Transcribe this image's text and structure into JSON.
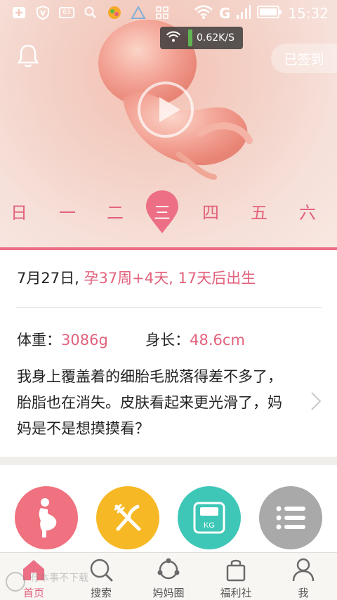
{
  "status_bar": {
    "battery_label": "63",
    "time": "15:32",
    "network_letter": "G"
  },
  "net_speed": "0.62K/S",
  "checkin_label": "已签到",
  "weekdays": [
    "日",
    "一",
    "二",
    "三",
    "四",
    "五",
    "六"
  ],
  "active_weekday_index": 3,
  "info": {
    "date": "7月27日,",
    "pregnancy": "孕37周+4天, 17天后出生",
    "weight_label": "体重：",
    "weight_value": "3086g",
    "length_label": "身长：",
    "length_value": "48.6cm",
    "description": "我身上覆盖着的细胎毛脱落得差不多了，胎脂也在消失。皮肤看起来更光滑了，妈妈是不是想摸摸看？"
  },
  "shortcuts": [
    {
      "icon": "pregnant-woman-icon",
      "color": "#f0717f"
    },
    {
      "icon": "fork-knife-icon",
      "color": "#f7b825"
    },
    {
      "icon": "scale-icon",
      "color": "#3ec7b7",
      "label": "KG"
    },
    {
      "icon": "list-menu-icon",
      "color": "#a9a9a9"
    }
  ],
  "bottom_nav": [
    {
      "label": "首页",
      "icon": "home-icon",
      "active": true
    },
    {
      "label": "搜索",
      "icon": "search-icon",
      "active": false
    },
    {
      "label": "妈妈圈",
      "icon": "community-icon",
      "active": false
    },
    {
      "label": "福利社",
      "icon": "shopping-bag-icon",
      "active": false
    },
    {
      "label": "我",
      "icon": "user-icon",
      "active": false
    }
  ],
  "watermark": "有本事不下载"
}
